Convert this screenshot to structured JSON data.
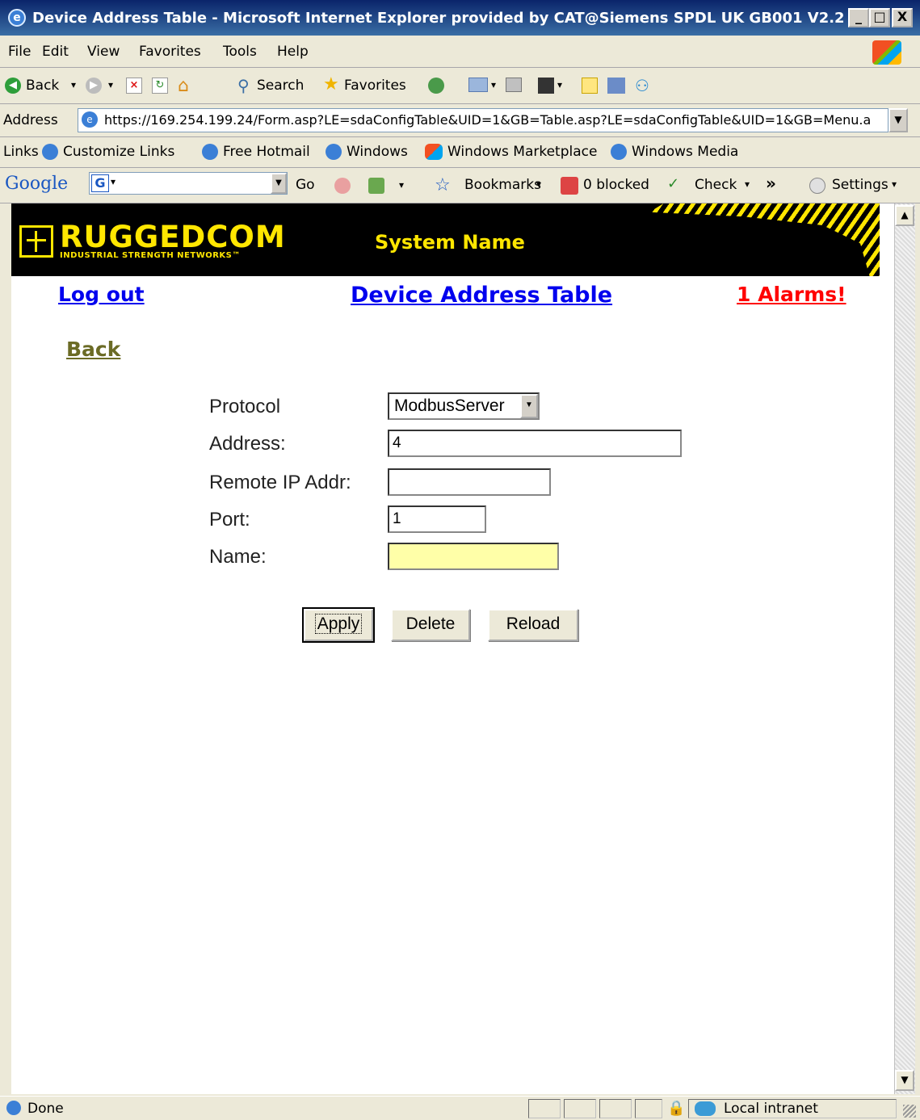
{
  "window": {
    "title": "Device Address Table - Microsoft Internet Explorer provided by CAT@Siemens SPDL UK GB001 V2.2",
    "minimize": "_",
    "maximize": "□",
    "close": "X"
  },
  "menu": [
    "File",
    "Edit",
    "View",
    "Favorites",
    "Tools",
    "Help"
  ],
  "toolbar": {
    "back": "Back",
    "search": "Search",
    "favorites": "Favorites"
  },
  "address": {
    "label": "Address",
    "url": "https://169.254.199.24/Form.asp?LE=sdaConfigTable&UID=1&GB=Table.asp?LE=sdaConfigTable&UID=1&GB=Menu.a"
  },
  "links": {
    "label": "Links",
    "items": [
      "Customize Links",
      "Free Hotmail",
      "Windows",
      "Windows Marketplace",
      "Windows Media"
    ]
  },
  "google": {
    "logo": "Google",
    "go": "Go",
    "bookmarks": "Bookmarks",
    "blocked": "0 blocked",
    "check": "Check",
    "more": "»",
    "settings": "Settings"
  },
  "page": {
    "brand": "RUGGEDCOM",
    "tagline": "INDUSTRIAL STRENGTH NETWORKS™",
    "system_name": "System Name",
    "logout": "Log out",
    "title": "Device Address Table",
    "alarms": "1 Alarms!",
    "back": "Back",
    "form": {
      "protocol_label": "Protocol",
      "protocol_value": "ModbusServer",
      "address_label": "Address:",
      "address_value": "4",
      "remote_ip_label": "Remote IP Addr:",
      "remote_ip_value": "",
      "port_label": "Port:",
      "port_value": "1",
      "name_label": "Name:",
      "name_value": ""
    },
    "buttons": {
      "apply": "Apply",
      "delete": "Delete",
      "reload": "Reload"
    }
  },
  "status": {
    "text": "Done",
    "zone": "Local intranet"
  },
  "colors": {
    "banner_yellow": "#ffe600",
    "link_blue": "#0000ee",
    "alarm_red": "#ff0000",
    "back_olive": "#6b6b25",
    "name_field_bg": "#ffffa8"
  }
}
